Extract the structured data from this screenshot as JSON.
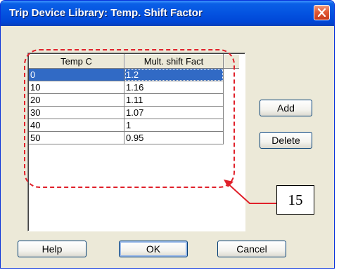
{
  "window": {
    "title": "Trip Device Library: Temp. Shift Factor",
    "close_icon": "close-icon"
  },
  "table": {
    "columns": [
      "Temp C",
      "Mult. shift Fact"
    ],
    "rows": [
      {
        "temp": "0",
        "factor": "1.2"
      },
      {
        "temp": "10",
        "factor": "1.16"
      },
      {
        "temp": "20",
        "factor": "1.11"
      },
      {
        "temp": "30",
        "factor": "1.07"
      },
      {
        "temp": "40",
        "factor": "1"
      },
      {
        "temp": "50",
        "factor": "0.95"
      }
    ],
    "selected_row": 0
  },
  "buttons": {
    "add": "Add",
    "delete": "Delete",
    "help": "Help",
    "ok": "OK",
    "cancel": "Cancel"
  },
  "annotation": {
    "callout_label": "15",
    "color": "#e0202a"
  },
  "colors": {
    "title_bar": "#0453e0",
    "selection": "#316ac5",
    "face": "#ece9d8"
  }
}
